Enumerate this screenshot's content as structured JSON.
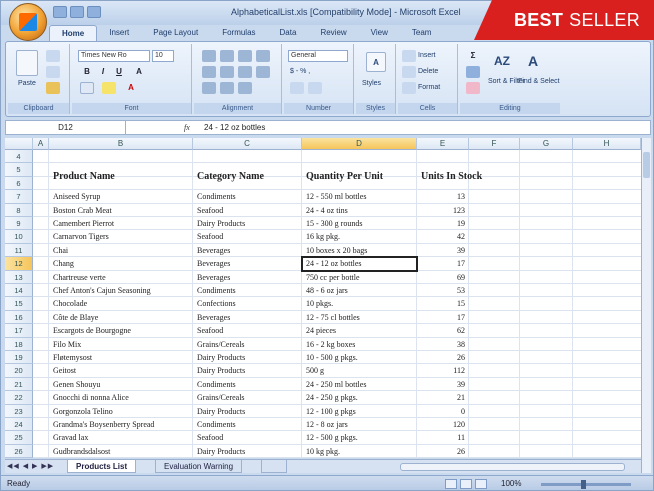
{
  "window": {
    "title": "AlphabeticalList.xls [Compatibility Mode] - Microsoft Excel"
  },
  "badge": {
    "strong": "BEST",
    "rest": "SELLER"
  },
  "ribbon": {
    "tabs": [
      "Home",
      "Insert",
      "Page Layout",
      "Formulas",
      "Data",
      "Review",
      "View",
      "Team"
    ],
    "active_tab": "Home",
    "groups": [
      "Clipboard",
      "Font",
      "Alignment",
      "Number",
      "Styles",
      "Cells",
      "Editing"
    ],
    "paste_label": "Paste",
    "font_name": "Times New Ro",
    "font_size": "10",
    "number_format": "General",
    "number_symbols": "$ - % ,",
    "styles_label": "Styles",
    "insert_label": "Insert",
    "delete_label": "Delete",
    "format_label": "Format",
    "sort_label": "Sort & Filter",
    "find_label": "Find & Select"
  },
  "formula_bar": {
    "name_box": "D12",
    "fx": "fx",
    "formula": "24 - 12 oz bottles"
  },
  "columns": [
    "A",
    "B",
    "C",
    "D",
    "E",
    "F",
    "G",
    "H"
  ],
  "selected_column": "D",
  "selected_row": "12",
  "rows_numbers": [
    "4",
    "5",
    "6",
    "7",
    "8",
    "9",
    "10",
    "11",
    "12",
    "13",
    "14",
    "15",
    "16",
    "17",
    "18",
    "19",
    "20",
    "21",
    "22",
    "23",
    "24",
    "25",
    "26"
  ],
  "table": {
    "headers": [
      "Product Name",
      "Category Name",
      "Quantity Per Unit",
      "Units In Stock"
    ],
    "rows": [
      [
        "Aniseed Syrup",
        "Condiments",
        "12 - 550 ml bottles",
        "13"
      ],
      [
        "Boston Crab Meat",
        "Seafood",
        "24 - 4 oz tins",
        "123"
      ],
      [
        "Camembert Pierrot",
        "Dairy Products",
        "15 - 300 g rounds",
        "19"
      ],
      [
        "Carnarvon Tigers",
        "Seafood",
        "16 kg pkg.",
        "42"
      ],
      [
        "Chai",
        "Beverages",
        "10 boxes x 20 bags",
        "39"
      ],
      [
        "Chang",
        "Beverages",
        "24 - 12 oz bottles",
        "17"
      ],
      [
        "Chartreuse verte",
        "Beverages",
        "750 cc per bottle",
        "69"
      ],
      [
        "Chef Anton's Cajun Seasoning",
        "Condiments",
        "48 - 6 oz jars",
        "53"
      ],
      [
        "Chocolade",
        "Confections",
        "10 pkgs.",
        "15"
      ],
      [
        "Côte de Blaye",
        "Beverages",
        "12 - 75 cl bottles",
        "17"
      ],
      [
        "Escargots de Bourgogne",
        "Seafood",
        "24 pieces",
        "62"
      ],
      [
        "Filo Mix",
        "Grains/Cereals",
        "16 - 2 kg boxes",
        "38"
      ],
      [
        "Fløtemysost",
        "Dairy Products",
        "10 - 500 g pkgs.",
        "26"
      ],
      [
        "Geitost",
        "Dairy Products",
        "500 g",
        "112"
      ],
      [
        "Genen Shouyu",
        "Condiments",
        "24 - 250 ml bottles",
        "39"
      ],
      [
        "Gnocchi di nonna Alice",
        "Grains/Cereals",
        "24 - 250 g pkgs.",
        "21"
      ],
      [
        "Gorgonzola Telino",
        "Dairy Products",
        "12 - 100 g pkgs",
        "0"
      ],
      [
        "Grandma's Boysenberry Spread",
        "Condiments",
        "12 - 8 oz jars",
        "120"
      ],
      [
        "Gravad lax",
        "Seafood",
        "12 - 500 g pkgs.",
        "11"
      ],
      [
        "Gudbrandsdalsost",
        "Dairy Products",
        "10 kg pkg.",
        "26"
      ]
    ]
  },
  "sheets": {
    "nav": "◀◀ ◀ ▶ ▶▶",
    "tabs": [
      "Products List",
      "Evaluation Warning"
    ]
  },
  "status": {
    "text": "Ready",
    "zoom": "100%"
  },
  "colors": {
    "badge": "#d9201f",
    "ribbon": "#d5e3f4",
    "selected_header": "#f5c55a"
  }
}
